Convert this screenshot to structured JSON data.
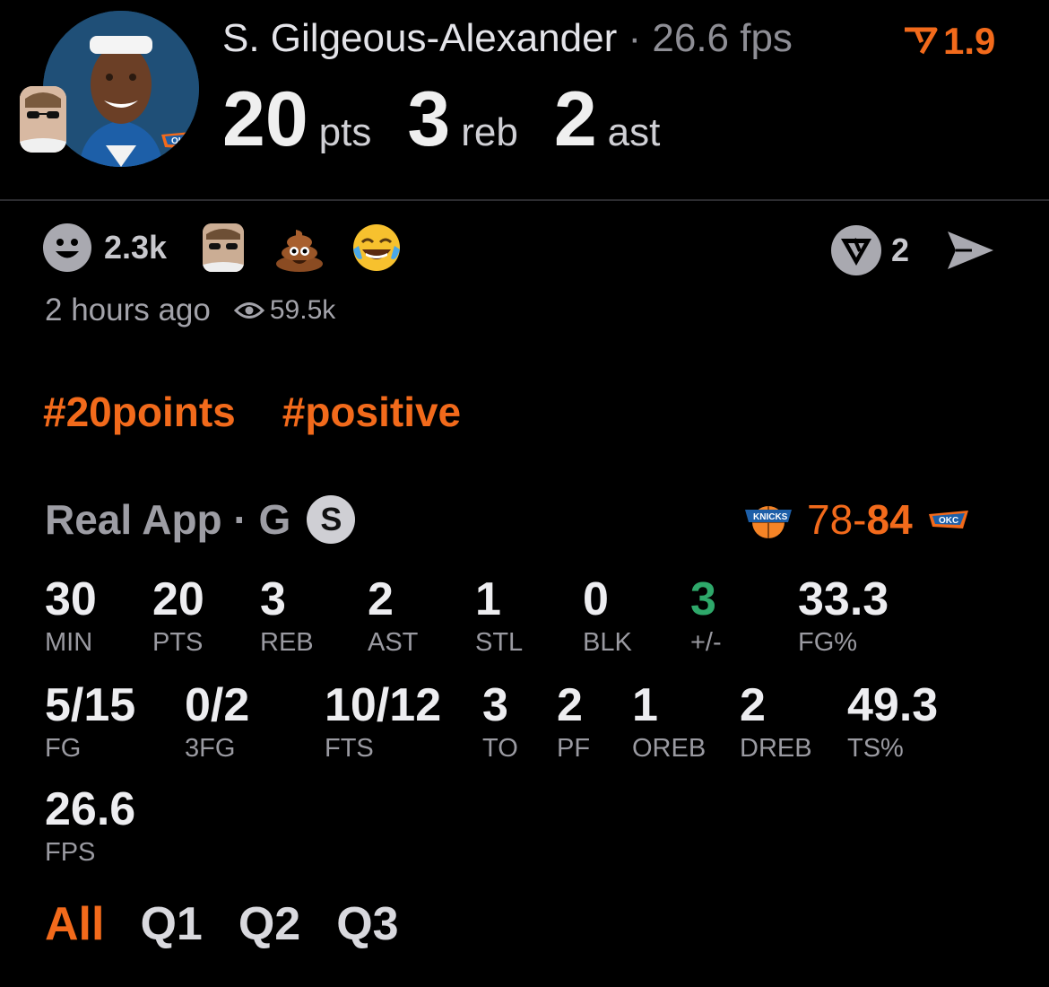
{
  "header": {
    "player_name": "S. Gilgeous-Alexander",
    "separator": "·",
    "fps_label": "26.6 fps",
    "vote_value": "1.9",
    "pts_value": "20",
    "pts_unit": "pts",
    "reb_value": "3",
    "reb_unit": "reb",
    "ast_value": "2",
    "ast_unit": "ast",
    "team_logo_text": "OKC"
  },
  "reactions": {
    "count": "2.3k",
    "emojis": [
      "sunglasses-user-icon",
      "poop-emoji",
      "tears-of-joy-emoji"
    ],
    "share_count": "2"
  },
  "meta": {
    "time": "2 hours ago",
    "views": "59.5k"
  },
  "hashtags": [
    "#20points",
    "#positive"
  ],
  "game": {
    "title": "Real App · G",
    "badge": "S",
    "score_away": "78",
    "score_home": "84",
    "score_sep": "-",
    "away_logo_text": "KNICKS",
    "home_logo_text": "OKC"
  },
  "stats": [
    {
      "value": "30",
      "label": "MIN"
    },
    {
      "value": "20",
      "label": "PTS"
    },
    {
      "value": "3",
      "label": "REB"
    },
    {
      "value": "2",
      "label": "AST"
    },
    {
      "value": "1",
      "label": "STL"
    },
    {
      "value": "0",
      "label": "BLK"
    },
    {
      "value": "3",
      "label": "+/-"
    },
    {
      "value": "33.3",
      "label": "FG%"
    },
    {
      "value": "5/15",
      "label": "FG"
    },
    {
      "value": "0/2",
      "label": "3FG"
    },
    {
      "value": "10/12",
      "label": "FTS"
    },
    {
      "value": "3",
      "label": "TO"
    },
    {
      "value": "2",
      "label": "PF"
    },
    {
      "value": "1",
      "label": "OREB"
    },
    {
      "value": "2",
      "label": "DREB"
    },
    {
      "value": "49.3",
      "label": "TS%"
    },
    {
      "value": "26.6",
      "label": "FPS"
    }
  ],
  "tabs": [
    "All",
    "Q1",
    "Q2",
    "Q3"
  ],
  "colors": {
    "accent": "#f26a1b",
    "positive": "#2ea86a",
    "background": "#000000"
  }
}
